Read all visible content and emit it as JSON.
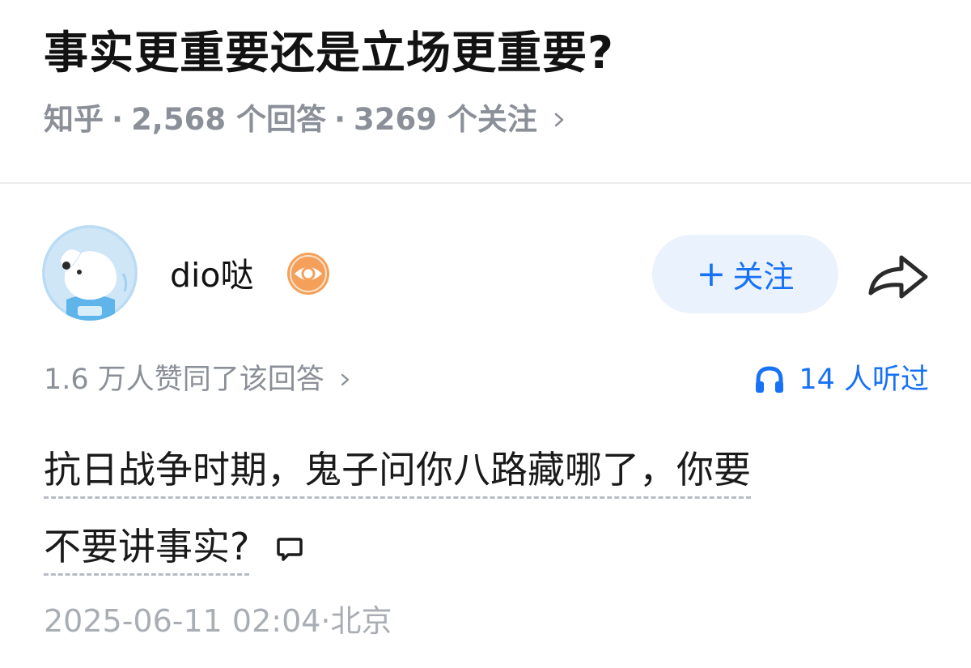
{
  "question": {
    "title": "事实更重要还是立场更重要?",
    "source": "知乎",
    "answers": "2,568 个回答",
    "followers": "3269 个关注",
    "sep": "·"
  },
  "author": {
    "name": "dio哒",
    "follow_label": "关注",
    "follow_plus": "+"
  },
  "stats": {
    "voters": "1.6 万人赞同了该回答",
    "listened": "14 人听过"
  },
  "answer": {
    "line1": "抗日战争时期，鬼子问你八路藏哪了，你要",
    "line2": "不要讲事实?"
  },
  "footer": {
    "timestamp": "2025-06-11 02:04·北京"
  },
  "colors": {
    "accent": "#1772f6",
    "muted": "#8a8f98",
    "badge": "#f5a05a"
  },
  "icons": [
    "chevron-right-icon",
    "avatar-dog-image",
    "eye-badge-icon",
    "share-arrow-icon",
    "headphones-icon",
    "comment-bubble-icon"
  ]
}
